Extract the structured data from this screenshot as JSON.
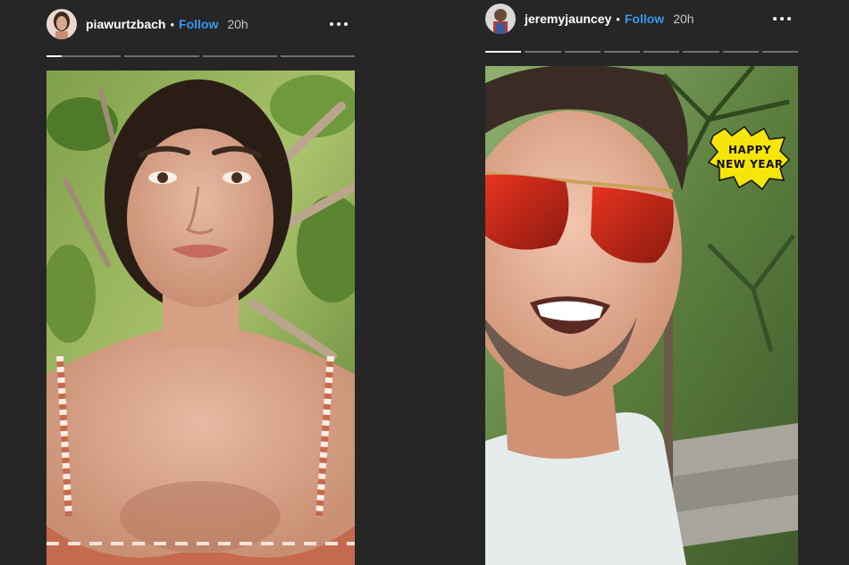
{
  "stories": [
    {
      "username": "piawurtzbach",
      "separator": "•",
      "follow_label": "Follow",
      "time": "20h",
      "segments": 4,
      "active_segment": 0,
      "active_progress": 0.2,
      "avatar_icon": "profile-photo-woman",
      "media_icon": "story-photo-woman-tropical-foliage"
    },
    {
      "username": "jeremyjauncey",
      "separator": "•",
      "follow_label": "Follow",
      "time": "20h",
      "segments": 8,
      "active_segment": 0,
      "active_progress": 1.0,
      "avatar_icon": "profile-photo-man",
      "media_icon": "story-photo-man-sunglasses-jungle",
      "sticker_lines": [
        "HAPPY",
        "NEW YEAR"
      ]
    }
  ],
  "colors": {
    "background": "#262626",
    "follow": "#3897f0",
    "sticker": "#f5e50a"
  }
}
